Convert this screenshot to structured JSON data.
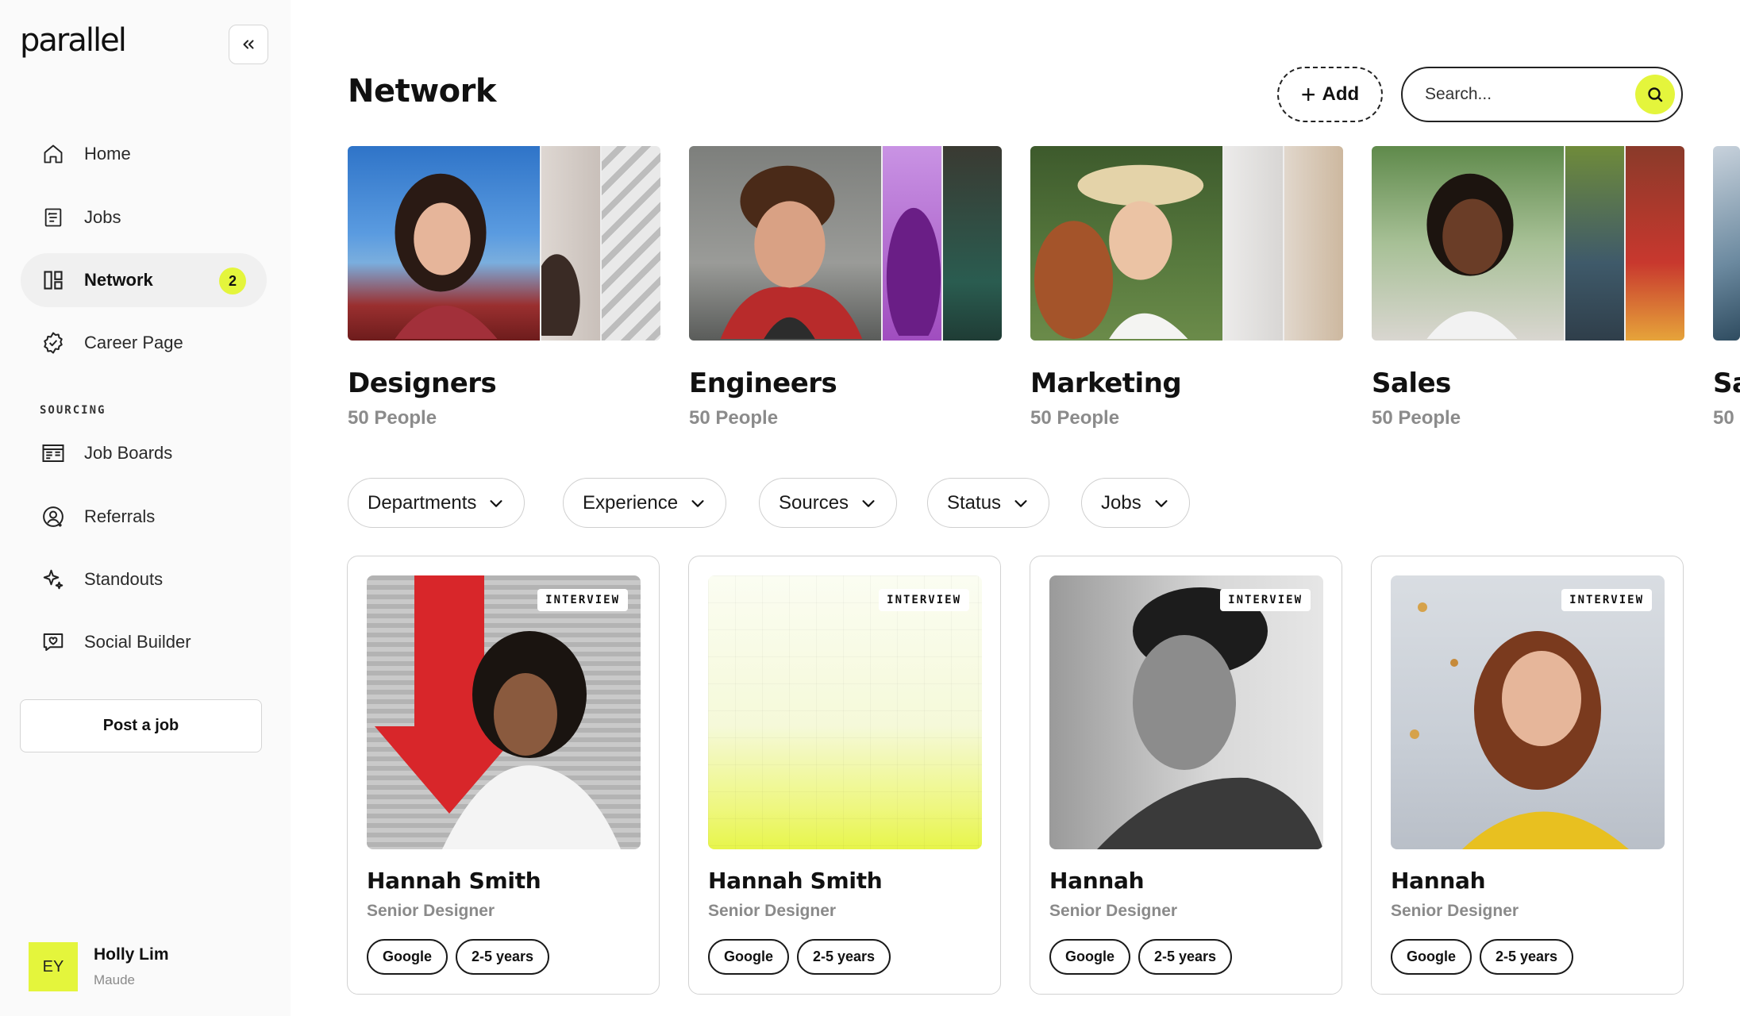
{
  "app": {
    "logo": "parallel"
  },
  "sidebar": {
    "items": [
      {
        "label": "Home",
        "icon": "home-icon"
      },
      {
        "label": "Jobs",
        "icon": "clipboard-icon"
      },
      {
        "label": "Network",
        "icon": "network-icon",
        "badge": "2",
        "active": true
      },
      {
        "label": "Career Page",
        "icon": "badge-check-icon"
      }
    ],
    "section_label": "SOURCING",
    "sourcing_items": [
      {
        "label": "Job Boards",
        "icon": "job-board-icon"
      },
      {
        "label": "Referrals",
        "icon": "referral-icon"
      },
      {
        "label": "Standouts",
        "icon": "sparkle-icon"
      },
      {
        "label": "Social Builder",
        "icon": "chat-heart-icon"
      }
    ],
    "post_job_label": "Post a job",
    "user": {
      "initials": "EY",
      "name": "Holly Lim",
      "subtitle": "Maude"
    }
  },
  "header": {
    "title": "Network",
    "add_label": "Add",
    "search_placeholder": "Search..."
  },
  "groups": [
    {
      "title": "Designers",
      "subtitle": "50 People"
    },
    {
      "title": "Engineers",
      "subtitle": "50 People"
    },
    {
      "title": "Marketing",
      "subtitle": "50 People"
    },
    {
      "title": "Sales",
      "subtitle": "50 People"
    },
    {
      "title": "Sa",
      "subtitle": "50"
    }
  ],
  "filters": [
    "Departments",
    "Experience",
    "Sources",
    "Status",
    "Jobs"
  ],
  "candidates": [
    {
      "status": "INTERVIEW",
      "name": "Hannah Smith",
      "role": "Senior Designer",
      "tags": [
        "Google",
        "2-5 years"
      ]
    },
    {
      "status": "INTERVIEW",
      "name": "Hannah Smith",
      "role": "Senior Designer",
      "tags": [
        "Google",
        "2-5 years"
      ]
    },
    {
      "status": "INTERVIEW",
      "name": "Hannah",
      "role": "Senior Designer",
      "tags": [
        "Google",
        "2-5 years"
      ]
    },
    {
      "status": "INTERVIEW",
      "name": "Hannah",
      "role": "Senior Designer",
      "tags": [
        "Google",
        "2-5 years"
      ]
    }
  ],
  "colors": {
    "accent": "#e4f53c",
    "text": "#111111",
    "muted": "#8a8a8a",
    "border": "#d2d2d2"
  }
}
